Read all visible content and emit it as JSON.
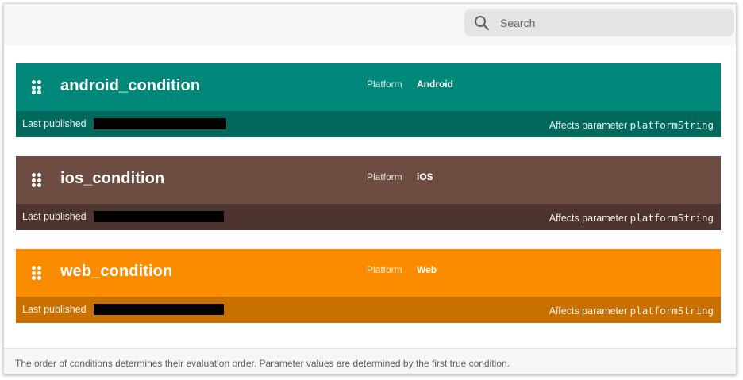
{
  "search": {
    "placeholder": "Search"
  },
  "conditions": [
    {
      "name": "android_condition",
      "platform_label": "Platform",
      "platform_value": "Android",
      "last_published_label": "Last published",
      "affects_label": "Affects parameter",
      "affects_param": "platformString",
      "color_primary": "#00897b",
      "color_secondary": "#00695c"
    },
    {
      "name": "ios_condition",
      "platform_label": "Platform",
      "platform_value": "iOS",
      "last_published_label": "Last published",
      "affects_label": "Affects parameter",
      "affects_param": "platformString",
      "color_primary": "#6d4c41",
      "color_secondary": "#4e342e"
    },
    {
      "name": "web_condition",
      "platform_label": "Platform",
      "platform_value": "Web",
      "last_published_label": "Last published",
      "affects_label": "Affects parameter",
      "affects_param": "platformString",
      "color_primary": "#fb8c00",
      "color_secondary": "#c87000"
    }
  ],
  "footer": {
    "text": "The order of conditions determines their evaluation order. Parameter values are determined by the first true condition."
  },
  "icons": {
    "search": "search-icon",
    "drag": "drag-handle-icon"
  }
}
